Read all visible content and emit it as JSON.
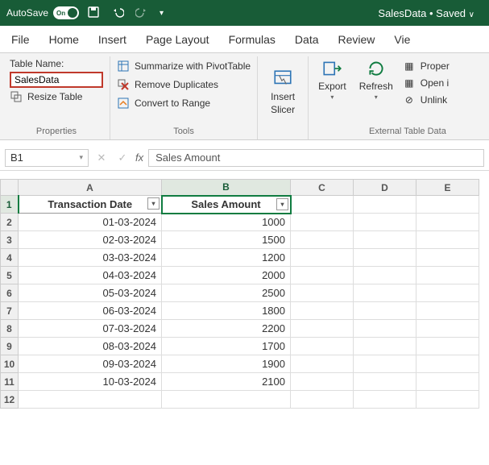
{
  "titlebar": {
    "autosave_label": "AutoSave",
    "toggle_state": "On",
    "doc_name": "SalesData",
    "save_state": "Saved"
  },
  "tabs": [
    "File",
    "Home",
    "Insert",
    "Page Layout",
    "Formulas",
    "Data",
    "Review",
    "Vie"
  ],
  "properties": {
    "label": "Table Name:",
    "table_name": "SalesData",
    "resize": "Resize Table",
    "group": "Properties"
  },
  "tools": {
    "pivot": "Summarize with PivotTable",
    "dup": "Remove Duplicates",
    "range": "Convert to Range",
    "group": "Tools"
  },
  "slicer": {
    "label1": "Insert",
    "label2": "Slicer"
  },
  "export": {
    "label": "Export"
  },
  "refresh": {
    "label": "Refresh"
  },
  "external": {
    "prop": "Proper",
    "open": "Open i",
    "unlink": "Unlink",
    "group": "External Table Data"
  },
  "namebox": {
    "ref": "B1"
  },
  "formula_bar": {
    "value": "Sales Amount"
  },
  "columns": [
    "A",
    "B",
    "C",
    "D",
    "E"
  ],
  "rows_hdr": [
    "1",
    "2",
    "3",
    "4",
    "5",
    "6",
    "7",
    "8",
    "9",
    "10",
    "11",
    "12"
  ],
  "table_headers": [
    "Transaction Date",
    "Sales Amount"
  ],
  "chart_data": {
    "type": "table",
    "columns": [
      "Transaction Date",
      "Sales Amount"
    ],
    "rows": [
      {
        "date": "01-03-2024",
        "amount": 1000
      },
      {
        "date": "02-03-2024",
        "amount": 1500
      },
      {
        "date": "03-03-2024",
        "amount": 1200
      },
      {
        "date": "04-03-2024",
        "amount": 2000
      },
      {
        "date": "05-03-2024",
        "amount": 2500
      },
      {
        "date": "06-03-2024",
        "amount": 1800
      },
      {
        "date": "07-03-2024",
        "amount": 2200
      },
      {
        "date": "08-03-2024",
        "amount": 1700
      },
      {
        "date": "09-03-2024",
        "amount": 1900
      },
      {
        "date": "10-03-2024",
        "amount": 2100
      }
    ]
  }
}
